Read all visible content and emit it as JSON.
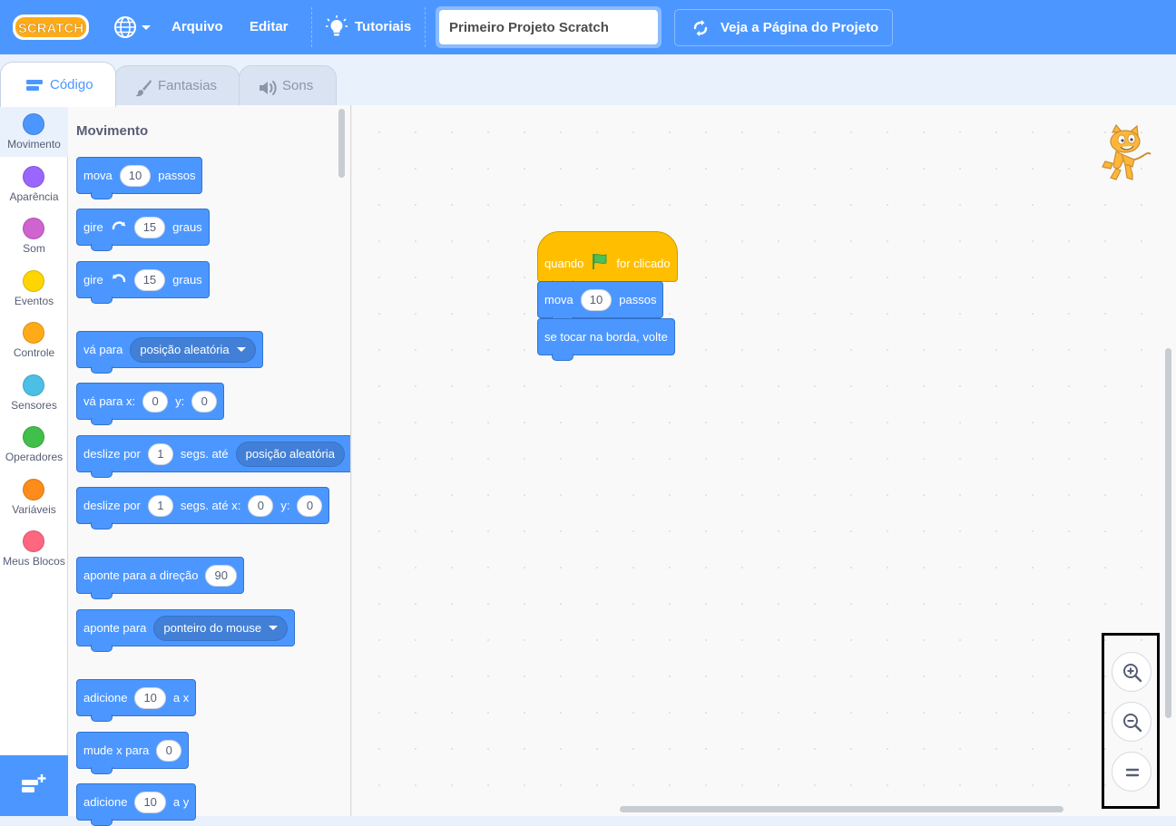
{
  "menubar": {
    "logo_text": "SCRATCH",
    "language_icon": "globe-icon",
    "file_label": "Arquivo",
    "edit_label": "Editar",
    "tutorials_label": "Tutoriais",
    "project_title": "Primeiro Projeto Scratch",
    "see_project_page_label": "Veja a Página do Projeto"
  },
  "tabs": {
    "code_label": "Código",
    "costumes_label": "Fantasias",
    "sounds_label": "Sons"
  },
  "categories": [
    {
      "label": "Movimento",
      "color": "#4c97ff"
    },
    {
      "label": "Aparência",
      "color": "#9966ff"
    },
    {
      "label": "Som",
      "color": "#cf63cf"
    },
    {
      "label": "Eventos",
      "color": "#ffd500"
    },
    {
      "label": "Controle",
      "color": "#ffab19"
    },
    {
      "label": "Sensores",
      "color": "#4cbfe6"
    },
    {
      "label": "Operadores",
      "color": "#40bf4a"
    },
    {
      "label": "Variáveis",
      "color": "#ff8c1a"
    },
    {
      "label": "Meus Blocos",
      "color": "#ff6680"
    }
  ],
  "palette": {
    "section_title": "Movimento",
    "move": {
      "text1": "mova",
      "value": "10",
      "text2": "passos"
    },
    "turn_right": {
      "text1": "gire",
      "value": "15",
      "text2": "graus"
    },
    "turn_left": {
      "text1": "gire",
      "value": "15",
      "text2": "graus"
    },
    "goto": {
      "text1": "vá para",
      "option": "posição aleatória"
    },
    "goto_xy": {
      "text1": "vá para x:",
      "x": "0",
      "text2": "y:",
      "y": "0"
    },
    "glide_to": {
      "text1": "deslize por",
      "secs": "1",
      "text2": "segs. até",
      "option": "posição aleatória"
    },
    "glide_xy": {
      "text1": "deslize por",
      "secs": "1",
      "text2": "segs. até x:",
      "x": "0",
      "text3": "y:",
      "y": "0"
    },
    "point_direction": {
      "text1": "aponte para a direção",
      "value": "90"
    },
    "point_towards": {
      "text1": "aponte para",
      "option": "ponteiro do mouse"
    },
    "change_x": {
      "text1": "adicione",
      "value": "10",
      "text2": "a x"
    },
    "set_x": {
      "text1": "mude x para",
      "value": "0"
    },
    "change_y": {
      "text1": "adicione",
      "value": "10",
      "text2": "a y"
    }
  },
  "script": {
    "hat": {
      "text1": "quando",
      "text2": "for clicado"
    },
    "move": {
      "text1": "mova",
      "value": "10",
      "text2": "passos"
    },
    "bounce": {
      "text1": "se tocar na borda, volte"
    }
  },
  "colors": {
    "motion": "#4c97ff",
    "events": "#ffbf00",
    "menubar": "#4c97ff"
  }
}
